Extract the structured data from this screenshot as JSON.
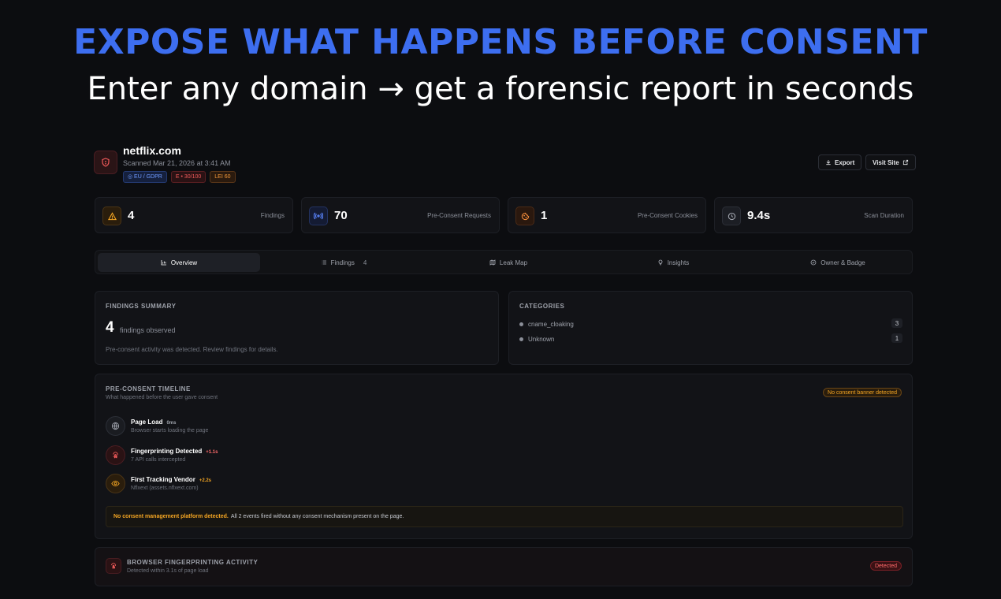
{
  "hero": {
    "title": "EXPOSE WHAT HAPPENS BEFORE CONSENT",
    "subtitle": "Enter any domain → get a forensic report in seconds"
  },
  "site": {
    "domain": "netflix.com",
    "scanned": "Scanned Mar 21, 2026 at 3:41 AM",
    "badges": [
      "◎ EU / GDPR",
      "E • 30/100",
      "LEI 60"
    ]
  },
  "header_buttons": {
    "export": "Export",
    "visit": "Visit Site"
  },
  "stats": [
    {
      "value": "4",
      "label": "Findings",
      "icon": "warning-icon"
    },
    {
      "value": "70",
      "label": "Pre-Consent Requests",
      "icon": "broadcast-icon"
    },
    {
      "value": "1",
      "label": "Pre-Consent Cookies",
      "icon": "cookie-icon"
    },
    {
      "value": "9.4s",
      "label": "Scan Duration",
      "icon": "clock-icon"
    }
  ],
  "tabs": [
    {
      "label": "Overview",
      "icon": "chart-icon",
      "active": true
    },
    {
      "label": "Findings",
      "count": "4",
      "icon": "list-icon"
    },
    {
      "label": "Leak Map",
      "icon": "map-icon"
    },
    {
      "label": "Insights",
      "icon": "lightbulb-icon"
    },
    {
      "label": "Owner & Badge",
      "icon": "check-circle-icon"
    }
  ],
  "summary": {
    "title": "FINDINGS SUMMARY",
    "count": "4",
    "count_label": "findings observed",
    "description": "Pre-consent activity was detected. Review findings for details."
  },
  "categories": {
    "title": "CATEGORIES",
    "items": [
      {
        "name": "cname_cloaking",
        "count": "3"
      },
      {
        "name": "Unknown",
        "count": "1"
      }
    ]
  },
  "timeline": {
    "title": "PRE-CONSENT TIMELINE",
    "subtitle": "What happened before the user gave consent",
    "status": "No consent banner detected",
    "events": [
      {
        "name": "Page Load",
        "time": "0ms",
        "desc": "Browser starts loading the page",
        "icon": "globe-icon"
      },
      {
        "name": "Fingerprinting Detected",
        "time": "+1.1s",
        "desc": "7 API calls intercepted",
        "icon": "fingerprint-icon"
      },
      {
        "name": "First Tracking Vendor",
        "time": "+2.2s",
        "desc": "Nflxext (assets.nflxext.com)",
        "icon": "eye-icon"
      }
    ],
    "warning_bold": "No consent management platform detected.",
    "warning_text": "All 2 events fired without any consent mechanism present on the page."
  },
  "fingerprinting": {
    "title": "BROWSER FINGERPRINTING ACTIVITY",
    "subtitle": "Detected within 3.1s of page load",
    "status": "Detected"
  },
  "colors": {
    "background": "#0c0d10",
    "accent_blue": "#3d6ef0",
    "warning": "#f5a623",
    "danger": "#ff6b6b"
  }
}
